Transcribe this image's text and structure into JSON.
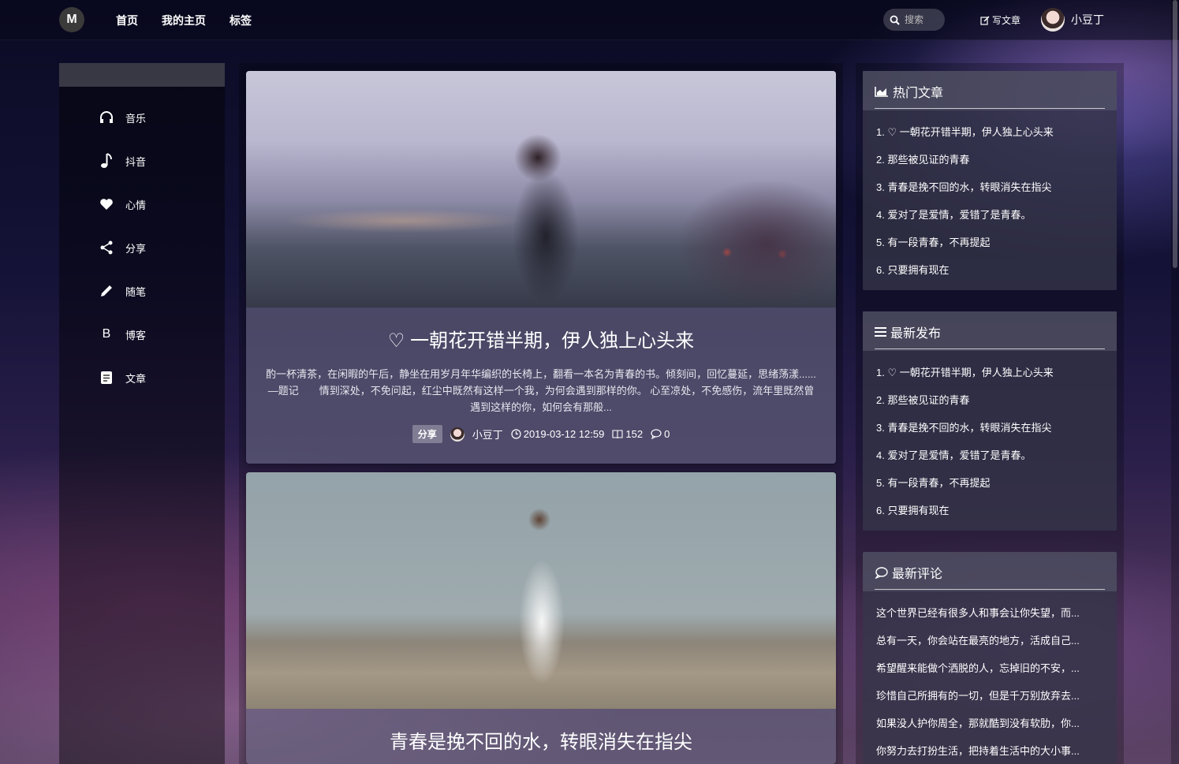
{
  "header": {
    "logo": "M",
    "nav": [
      "首页",
      "我的主页",
      "标签"
    ],
    "search_placeholder": "搜索",
    "write_label": "写文章",
    "username": "小豆丁"
  },
  "sidebar": {
    "items": [
      {
        "icon": "headphones-icon",
        "label": "音乐"
      },
      {
        "icon": "music-note-icon",
        "label": "抖音"
      },
      {
        "icon": "heart-icon",
        "label": "心情"
      },
      {
        "icon": "share-icon",
        "label": "分享"
      },
      {
        "icon": "pencil-icon",
        "label": "随笔"
      },
      {
        "icon": "b-letter-icon",
        "label": "博客"
      },
      {
        "icon": "document-icon",
        "label": "文章"
      }
    ]
  },
  "posts": [
    {
      "title": "♡ 一朝花开错半期，伊人独上心头来",
      "excerpt": "酌一杯清茶，在闲暇的午后，静坐在用岁月年华编织的长椅上，翻看一本名为青春的书。倾刻间，回忆蔓延，思绪荡漾...... —题记　　情到深处，不免问起，红尘中既然有这样一个我，为何会遇到那样的你。 心至凉处，不免感伤，流年里既然曾遇到这样的你，如何会有那般...",
      "tag": "分享",
      "author": "小豆丁",
      "date": "2019-03-12 12:59",
      "views": "152",
      "comments": "0"
    },
    {
      "title": "青春是挽不回的水，转眼消失在指尖"
    }
  ],
  "widgets": {
    "hot": {
      "title": "热门文章",
      "items": [
        "1. ♡ 一朝花开错半期，伊人独上心头来",
        "2. 那些被见证的青春",
        "3. 青春是挽不回的水，转眼消失在指尖",
        "4. 爱对了是爱情，爱错了是青春。",
        "5. 有一段青春，不再提起",
        "6. 只要拥有现在"
      ]
    },
    "latest": {
      "title": "最新发布",
      "items": [
        "1. ♡ 一朝花开错半期，伊人独上心头来",
        "2. 那些被见证的青春",
        "3. 青春是挽不回的水，转眼消失在指尖",
        "4. 爱对了是爱情，爱错了是青春。",
        "5. 有一段青春，不再提起",
        "6. 只要拥有现在"
      ]
    },
    "comments": {
      "title": "最新评论",
      "items": [
        "这个世界已经有很多人和事会让你失望，而...",
        "总有一天，你会站在最亮的地方，活成自己...",
        "希望醒来能做个洒脱的人，忘掉旧的不安，...",
        "珍惜自己所拥有的一切，但是千万别放弃去...",
        "如果没人护你周全，那就酷到没有软肋，你...",
        "你努力去打扮生活，把持着生活中的大小事..."
      ]
    }
  }
}
